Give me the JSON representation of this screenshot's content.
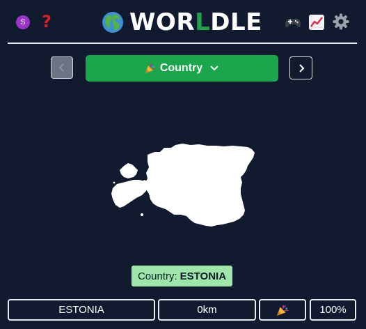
{
  "header": {
    "user_initial": "S",
    "title_before": "WOR",
    "title_highlight": "L",
    "title_after": "DLE",
    "icons": {
      "help": "question-mark-icon",
      "globe": "globe-icon",
      "controller": "game-controller-icon",
      "stats": "chart-increasing-icon",
      "settings": "gear-icon"
    },
    "help_glyph": "?"
  },
  "toolbar": {
    "mode_label": "Country",
    "colors": {
      "mode_bg": "#1aa64a",
      "prev_bg": "#6c7483"
    }
  },
  "answer": {
    "prefix": "Country:",
    "value": "ESTONIA"
  },
  "guess": {
    "name": "ESTONIA",
    "distance": "0km",
    "direction_icon": "party-popper-icon",
    "proximity": "100%"
  },
  "colors": {
    "background": "#111a2e",
    "accent_green": "#1aa64a",
    "title_l": "#1fa34a",
    "answer_bg": "#9ee6a9",
    "help_red": "#d3222a",
    "badge_purple": "#9b35c9"
  }
}
